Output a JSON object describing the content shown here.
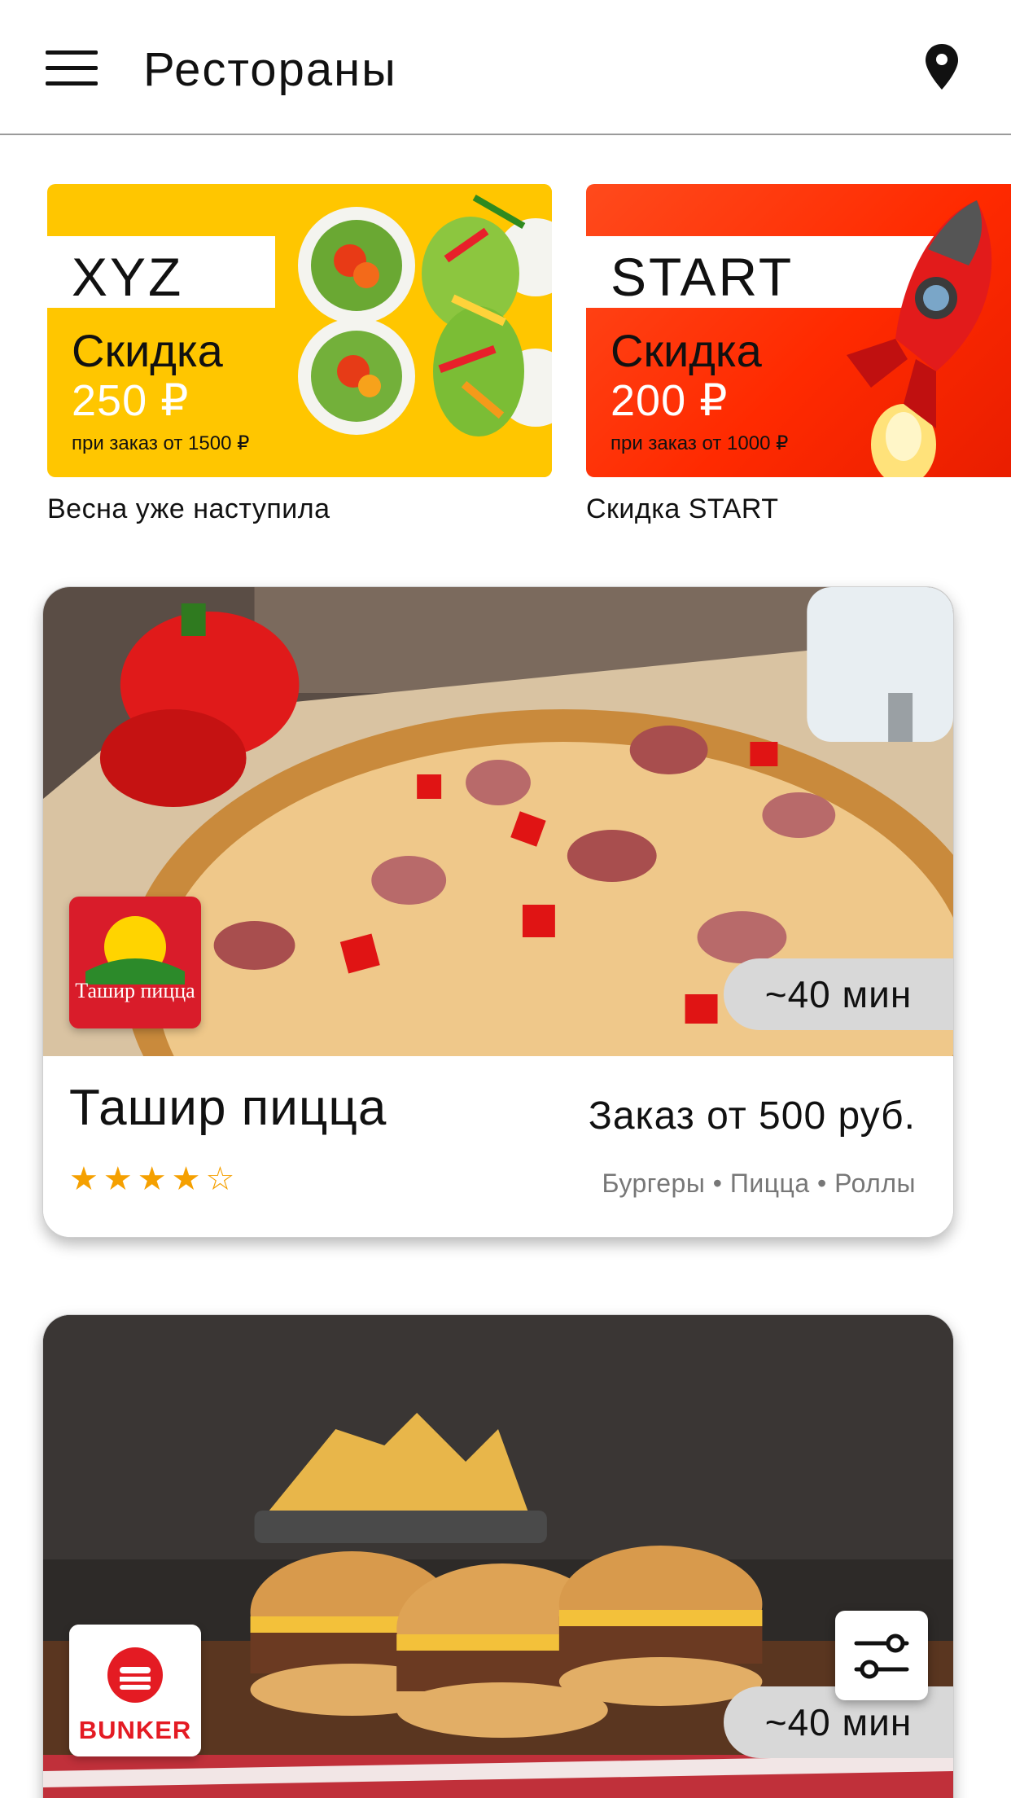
{
  "header": {
    "title": "Рестораны",
    "menu_icon": "hamburger-menu-icon",
    "location_icon": "location-pin-icon"
  },
  "promos": [
    {
      "code": "XYZ",
      "label": "Скидка",
      "amount": "250 ₽",
      "condition": "при заказ от 1500 ₽",
      "caption": "Весна уже наступила",
      "color": "#ffc600"
    },
    {
      "code": "START",
      "label": "Скидка",
      "amount": "200 ₽",
      "condition": "при заказ от 1000 ₽",
      "caption": "Скидка START",
      "color": "#ff3300"
    }
  ],
  "restaurants": [
    {
      "name": "Ташир пицца",
      "logo_text": "Ташир пицца",
      "delivery_time": "~40 мин",
      "min_order": "Заказ от 500 руб.",
      "categories": "Бургеры • Пицца • Роллы",
      "rating_stars": "★★★★☆",
      "rating": 4
    },
    {
      "name": "BUNKER",
      "logo_text": "BUNKER",
      "delivery_time": "~40 мин"
    }
  ],
  "colors": {
    "accent_star": "#f5a000",
    "badge_bg": "#d8d8d8"
  }
}
